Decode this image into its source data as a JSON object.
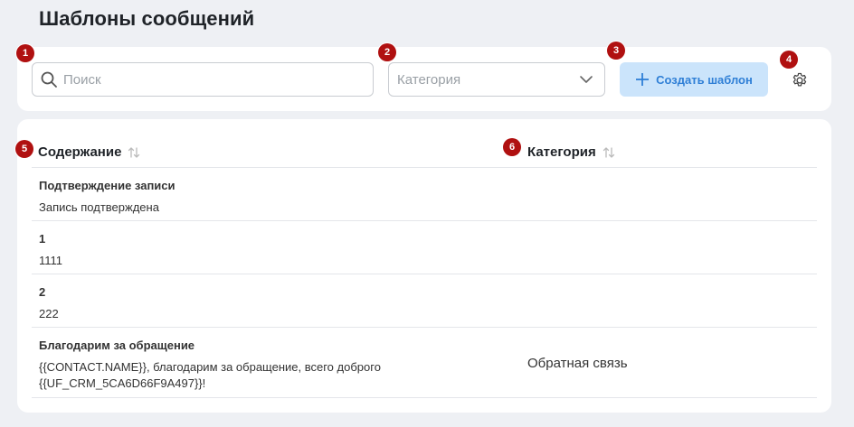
{
  "page": {
    "title": "Шаблоны сообщений"
  },
  "toolbar": {
    "search_placeholder": "Поиск",
    "category_placeholder": "Категория",
    "create_label": "Создать шаблон"
  },
  "table": {
    "columns": {
      "content": "Содержание",
      "category": "Категория"
    },
    "rows": [
      {
        "title": "Подтверждение записи",
        "text": "Запись подтверждена",
        "category": ""
      },
      {
        "title": "1",
        "text": "1111",
        "category": ""
      },
      {
        "title": "2",
        "text": "222",
        "category": ""
      },
      {
        "title": "Благодарим за обращение",
        "text": "{{CONTACT.NAME}}, благодарим за обращение, всего доброго {{UF_CRM_5CA6D66F9A497}}!",
        "category": "Обратная связь"
      }
    ]
  },
  "annotations": [
    "1",
    "2",
    "3",
    "4",
    "5",
    "6"
  ],
  "colors": {
    "accent": "#2f7fd6",
    "button_bg": "#cbe4fb",
    "badge": "#b01010"
  },
  "icons": [
    "search-icon",
    "chevron-down-icon",
    "plus-icon",
    "gear-icon",
    "sort-icon"
  ]
}
